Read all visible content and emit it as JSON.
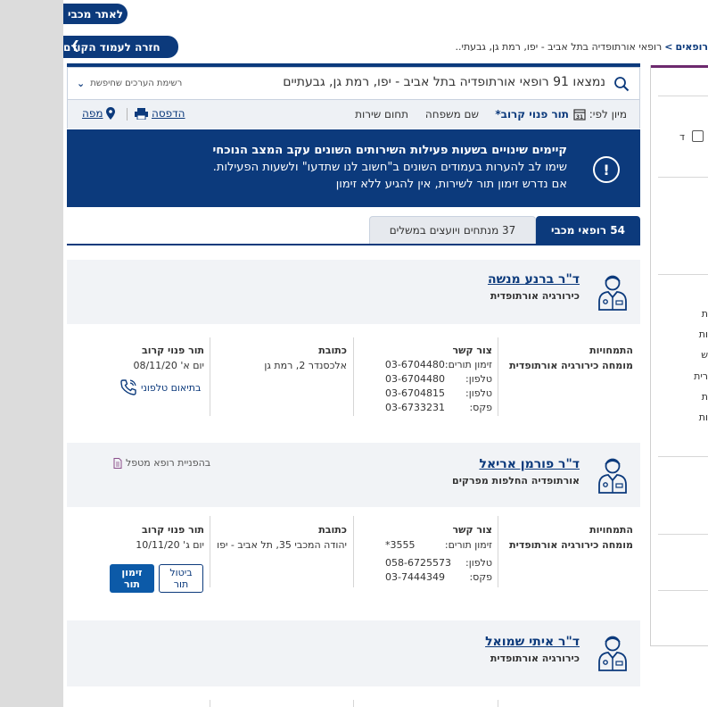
{
  "nav": {
    "to_site": "לאתר מכבי",
    "back": "חזרה לעמוד הקודם",
    "breadcrumb": [
      "רופאים",
      "רופאי אורתופדיה בתל אביב - יפו, רמת גן, גבעתי..."
    ]
  },
  "search": {
    "results_text": "נמצאו 91 רופאי אורתופדיה בתל אביב - יפו, רמת גן, גבעתיים",
    "dropdown_label": "רשימת הערכים שחיפשת"
  },
  "sort": {
    "label": "מיון לפי:",
    "options": [
      "תור פנוי קרוב*",
      "שם משפחה",
      "תחום שירות"
    ],
    "print": "הדפסה",
    "map": "מפה"
  },
  "alert": {
    "line1": "קיימים שינויים בשעות פעילות השירותים השונים עקב המצב הנוכחי",
    "line2": "שימו לב להערות בעמודים השונים ב\"חשוב לנו שתדעו\" ולשעות הפעילות.",
    "line3": "אם נדרש זימון תור לשירות, אין להגיע ללא זימון"
  },
  "tabs": [
    {
      "label": "54 רופאי מכבי",
      "active": true
    },
    {
      "label": "37 מנתחים ויועצים במשלים",
      "active": false
    }
  ],
  "columns": {
    "specialties": "התמחויות",
    "contact": "צור קשר",
    "address": "כתובת",
    "next_appt": "תור פנוי קרוב"
  },
  "doctors": [
    {
      "name": "ד\"ר ברנע מנשה",
      "specialty": "כירורגיה אורתופדית",
      "expertise": "מומחה כירורגיה אורתופדית",
      "contacts": [
        {
          "label": "זימון תורים:",
          "value": "03-6704480"
        },
        {
          "label": "טלפון:",
          "value": "03-6704480"
        },
        {
          "label": "טלפון:",
          "value": "03-6704815"
        },
        {
          "label": "פקס:",
          "value": "03-6733231"
        }
      ],
      "address": "אלכסנדר 2, רמת גן",
      "appt_date": "יום א' 08/11/20",
      "phone_coord": "בתיאום טלפוני"
    },
    {
      "name": "ד\"ר פורמן אריאל",
      "specialty": "אורתופדיה החלפות מפרקים",
      "referral": "בהפניית רופא מטפל",
      "expertise": "מומחה כירורגיה אורתופדית",
      "contacts": [
        {
          "label": "זימון תורים:",
          "value": "*3555"
        },
        {
          "label": "טלפון:",
          "value": "058-6725573"
        },
        {
          "label": "פקס:",
          "value": "03-7444349"
        }
      ],
      "address": "יהודה המכבי 35, תל אביב - יפו",
      "appt_date": "יום ג' 10/11/20",
      "cancel_label": "ביטול תור",
      "book_label": "זימון תור"
    },
    {
      "name": "ד\"ר איתי שמואל",
      "specialty": "כירורגיה אורתופדית"
    }
  ],
  "right_panel": {
    "checkbox_label": "ד",
    "items": [
      "ת",
      "ות",
      "ש",
      "רית",
      "ת",
      "ות"
    ]
  },
  "colors": {
    "primary": "#0c3a7c",
    "accent": "#0c5aa8",
    "alert_bg": "#0c3a7c",
    "purple_bar": "#6d2a6e"
  }
}
